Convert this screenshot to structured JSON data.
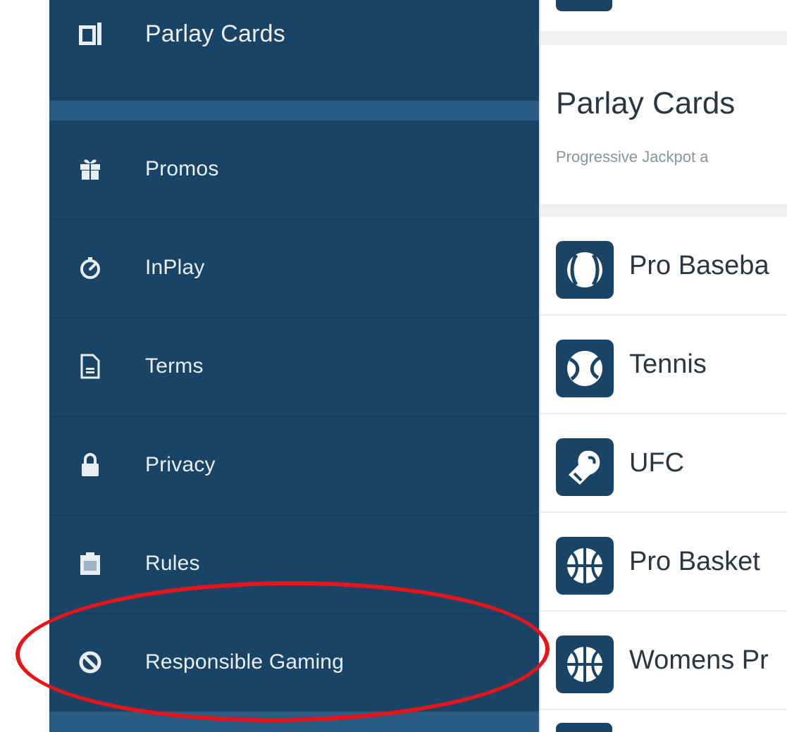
{
  "sidebar": {
    "items": [
      {
        "label": "Parlay Cards",
        "icon": "parlay-cards-icon"
      },
      {
        "label": "Promos",
        "icon": "gift-icon"
      },
      {
        "label": "InPlay",
        "icon": "stopwatch-icon"
      },
      {
        "label": "Terms",
        "icon": "document-icon"
      },
      {
        "label": "Privacy",
        "icon": "lock-icon"
      },
      {
        "label": "Rules",
        "icon": "clipboard-icon"
      },
      {
        "label": "Responsible Gaming",
        "icon": "prohibited-icon"
      }
    ]
  },
  "main": {
    "section_title": "Parlay Cards",
    "section_subtitle": "Progressive Jackpot a",
    "sports": [
      {
        "label": "Pro Baseba",
        "icon": "baseball-icon"
      },
      {
        "label": "Tennis",
        "icon": "tennis-ball-icon"
      },
      {
        "label": "UFC",
        "icon": "boxing-glove-icon"
      },
      {
        "label": "Pro Basket",
        "icon": "basketball-icon"
      },
      {
        "label": "Womens Pr",
        "icon": "basketball-icon"
      }
    ]
  },
  "colors": {
    "sidebar_bg": "#1a4466",
    "sidebar_band": "#2a5b82",
    "highlight": "#e8141a",
    "main_text": "#2c3540"
  }
}
